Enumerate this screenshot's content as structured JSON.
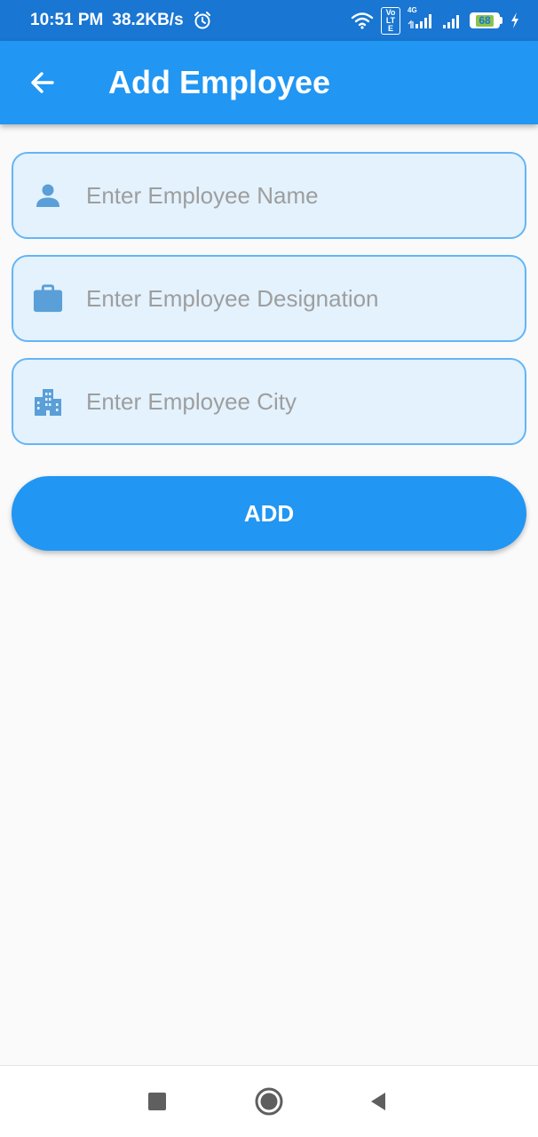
{
  "status_bar": {
    "time": "10:51 PM",
    "net_speed": "38.2KB/s",
    "volte_label": "Vo LTE",
    "network_type": "4G",
    "battery_level": "68"
  },
  "app_bar": {
    "title": "Add Employee"
  },
  "form": {
    "name_field": {
      "placeholder": "Enter Employee Name",
      "icon": "person-icon",
      "value": ""
    },
    "designation_field": {
      "placeholder": "Enter Employee Designation",
      "icon": "briefcase-icon",
      "value": ""
    },
    "city_field": {
      "placeholder": "Enter Employee City",
      "icon": "city-icon",
      "value": ""
    },
    "add_button_label": "ADD"
  },
  "nav_bar": {
    "buttons": [
      "recents-icon",
      "home-icon",
      "back-icon"
    ]
  },
  "colors": {
    "status_bar": "#1976d2",
    "primary": "#2196f3",
    "field_fill": "#e3f2fd",
    "field_border": "#64b5f6",
    "icon_color": "#5a9fd8",
    "placeholder": "#9e9e9e",
    "background": "#fafafa"
  }
}
